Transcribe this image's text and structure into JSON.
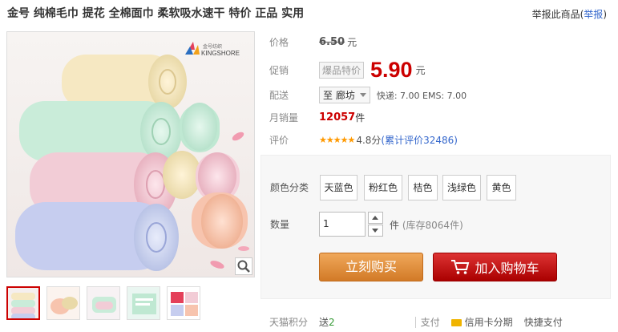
{
  "product": {
    "title": "金号 纯棉毛巾 提花 全棉面巾 柔软吸水速干 特价 正品 实用",
    "report_text": "举报此商品(",
    "report_link": "举报",
    "report_close": ")",
    "brand_logo_text": "KINGSHORE",
    "brand_logo_cn": "金号纺织"
  },
  "price": {
    "label": "价格",
    "original": "6.50",
    "unit": "元"
  },
  "promo": {
    "label": "促销",
    "tag": "爆品特价",
    "price": "5.90",
    "unit": "元"
  },
  "shipping": {
    "label": "配送",
    "destination": "至 廊坊",
    "detail": "快递: 7.00 EMS: 7.00"
  },
  "sales": {
    "label": "月销量",
    "count": "12057",
    "unit": "件"
  },
  "rating": {
    "label": "评价",
    "stars": "★★★★★",
    "score": "4.8分",
    "review_link": "(累计评价32486)"
  },
  "sku": {
    "color_label": "颜色分类",
    "colors": [
      "天蓝色",
      "粉红色",
      "桔色",
      "浅绿色",
      "黄色"
    ],
    "qty_label": "数量",
    "qty_value": "1",
    "qty_unit": "件",
    "stock": "(库存8064件)"
  },
  "actions": {
    "buy": "立刻购买",
    "cart": "加入购物车"
  },
  "bottom": {
    "points_label": "天猫积分",
    "points_text": "送",
    "points_value": "2",
    "pay_label": "支付",
    "pay_credit": "信用卡分期",
    "pay_fast": "快捷支付"
  },
  "colors": {
    "promo_red": "#cc0000",
    "buy_orange": "#d27a27",
    "cart_red": "#aa0000",
    "link_blue": "#3366cc"
  }
}
